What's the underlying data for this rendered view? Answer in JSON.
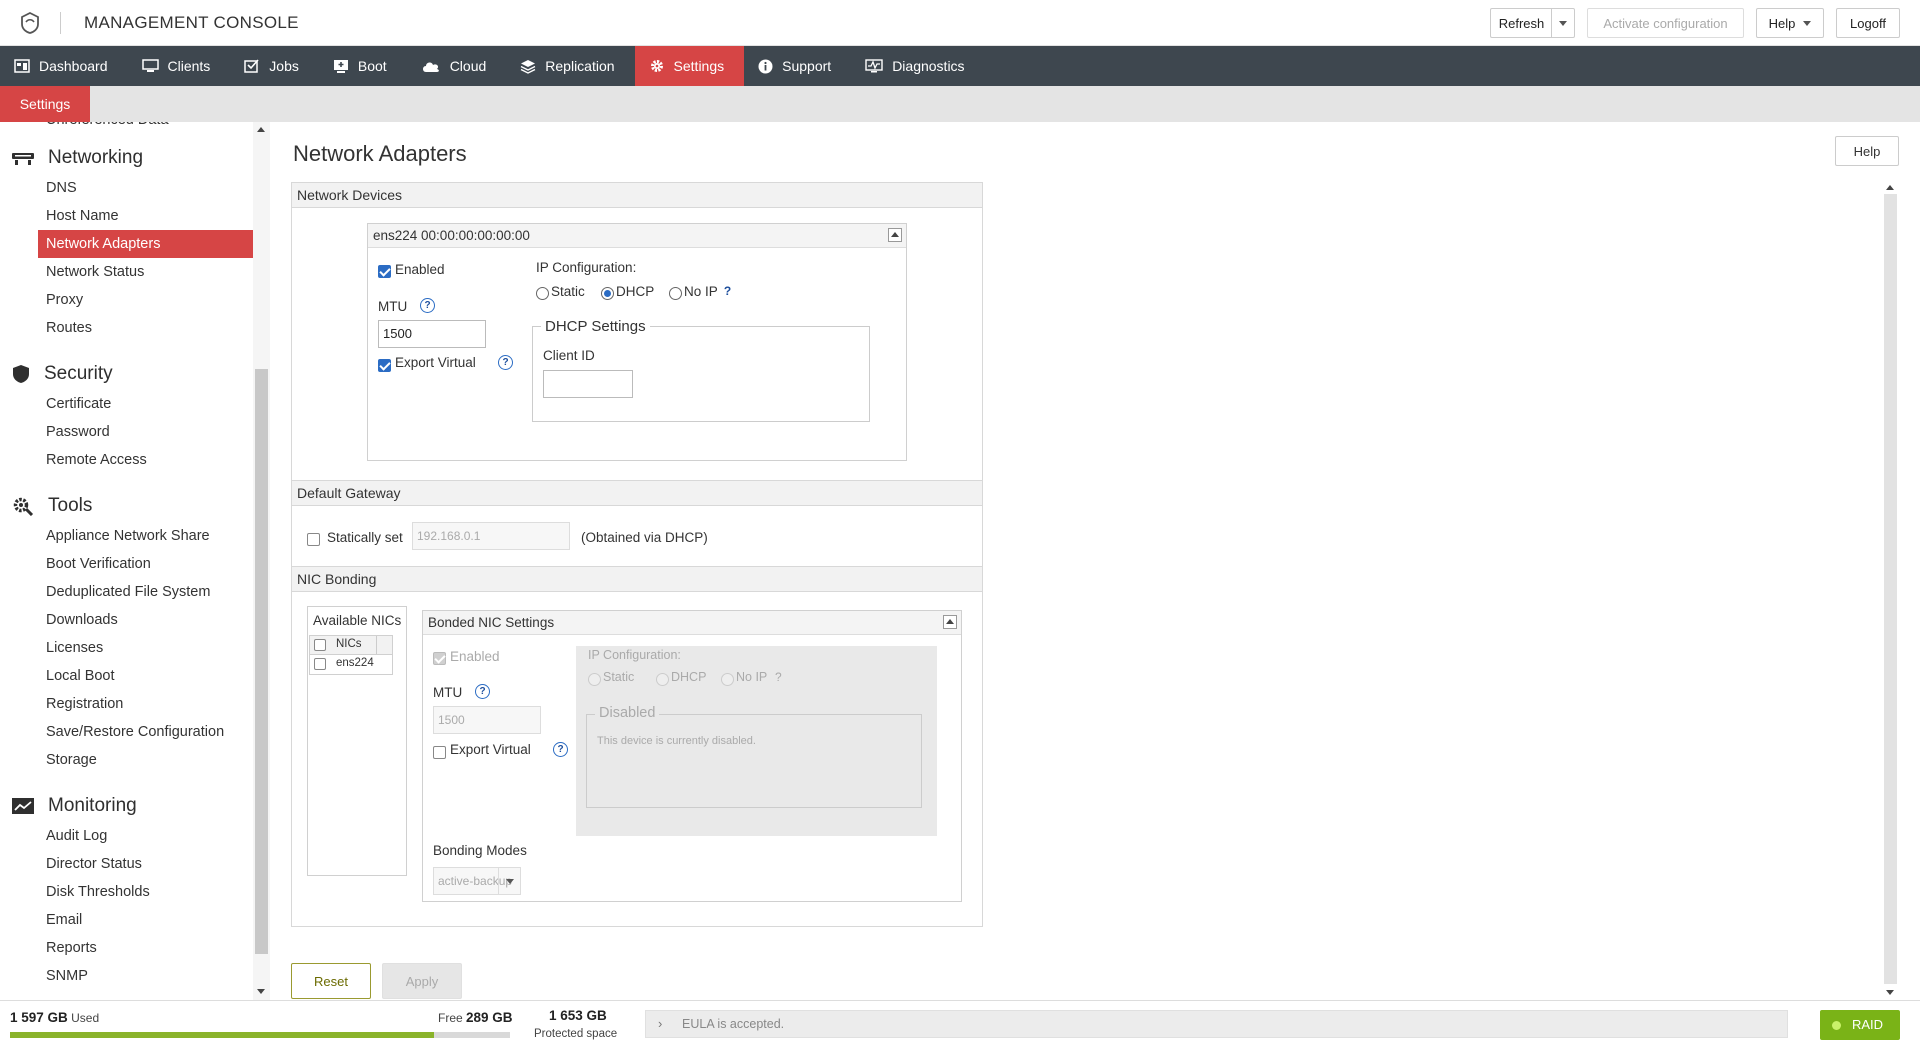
{
  "header": {
    "title": "MANAGEMENT CONSOLE",
    "refresh_label": "Refresh",
    "activate_label": "Activate configuration",
    "help_label": "Help",
    "logoff_label": "Logoff"
  },
  "nav": {
    "items": [
      {
        "label": "Dashboard",
        "icon": "dashboard-icon"
      },
      {
        "label": "Clients",
        "icon": "monitor-icon"
      },
      {
        "label": "Jobs",
        "icon": "jobs-icon"
      },
      {
        "label": "Boot",
        "icon": "boot-icon"
      },
      {
        "label": "Cloud",
        "icon": "cloud-icon"
      },
      {
        "label": "Replication",
        "icon": "layers-icon"
      },
      {
        "label": "Settings",
        "icon": "gear-icon",
        "active": true
      },
      {
        "label": "Support",
        "icon": "info-icon"
      },
      {
        "label": "Diagnostics",
        "icon": "diagnostics-icon"
      }
    ],
    "active_color": "#d64545"
  },
  "subnav": {
    "tab_label": "Settings"
  },
  "sidebar": {
    "truncated_item": "Unreferenced Data",
    "groups": [
      {
        "title": "Networking",
        "icon": "network-icon",
        "items": [
          "DNS",
          "Host Name",
          "Network Adapters",
          "Network Status",
          "Proxy",
          "Routes"
        ]
      },
      {
        "title": "Security",
        "icon": "shield-icon",
        "items": [
          "Certificate",
          "Password",
          "Remote Access"
        ]
      },
      {
        "title": "Tools",
        "icon": "tools-gear-icon",
        "items": [
          "Appliance Network Share",
          "Boot Verification",
          "Deduplicated File System",
          "Downloads",
          "Licenses",
          "Local Boot",
          "Registration",
          "Save/Restore Configuration",
          "Storage"
        ]
      },
      {
        "title": "Monitoring",
        "icon": "chart-line-icon",
        "items": [
          "Audit Log",
          "Director Status",
          "Disk Thresholds",
          "Email",
          "Reports",
          "SNMP"
        ]
      }
    ],
    "active_item": "Network Adapters"
  },
  "page": {
    "title": "Network Adapters",
    "help_label": "Help"
  },
  "network_devices": {
    "section_title": "Network Devices",
    "device_header": "ens224 00:00:00:00:00:00",
    "enabled_label": "Enabled",
    "enabled": true,
    "mtu_label": "MTU",
    "mtu_value": "1500",
    "export_virtual_label": "Export Virtual",
    "export_virtual": true,
    "ip_config_label": "IP Configuration:",
    "ip_options": [
      "Static",
      "DHCP",
      "No IP"
    ],
    "ip_selected": "DHCP",
    "help_glyph": "?",
    "dhcp_legend": "DHCP Settings",
    "client_id_label": "Client ID",
    "client_id_value": ""
  },
  "default_gateway": {
    "section_title": "Default Gateway",
    "statically_set_label": "Statically set",
    "statically_set": false,
    "gateway_value": "192.168.0.1",
    "obtained_note": "(Obtained via DHCP)"
  },
  "nic_bonding": {
    "section_title": "NIC Bonding",
    "available_title": "Available NICs",
    "nics_column": "NICs",
    "nics": [
      "ens224"
    ],
    "bonded_title": "Bonded NIC Settings",
    "enabled_label": "Enabled",
    "mtu_label": "MTU",
    "mtu_value": "1500",
    "export_virtual_label": "Export Virtual",
    "ip_config_label": "IP Configuration:",
    "ip_options": [
      "Static",
      "DHCP",
      "No IP"
    ],
    "disabled_legend": "Disabled",
    "disabled_text": "This device is currently disabled.",
    "bonding_modes_label": "Bonding Modes",
    "bonding_mode_value": "active-backup"
  },
  "actions": {
    "reset_label": "Reset",
    "apply_label": "Apply"
  },
  "footer": {
    "used_value": "1 597 GB",
    "used_label": "Used",
    "free_label": "Free",
    "free_value": "289 GB",
    "used_fraction": 0.847,
    "protected_value": "1 653 GB",
    "protected_label": "Protected space",
    "eula_text": "EULA is accepted.",
    "raid_label": "RAID",
    "raid_color": "#7ab317"
  }
}
